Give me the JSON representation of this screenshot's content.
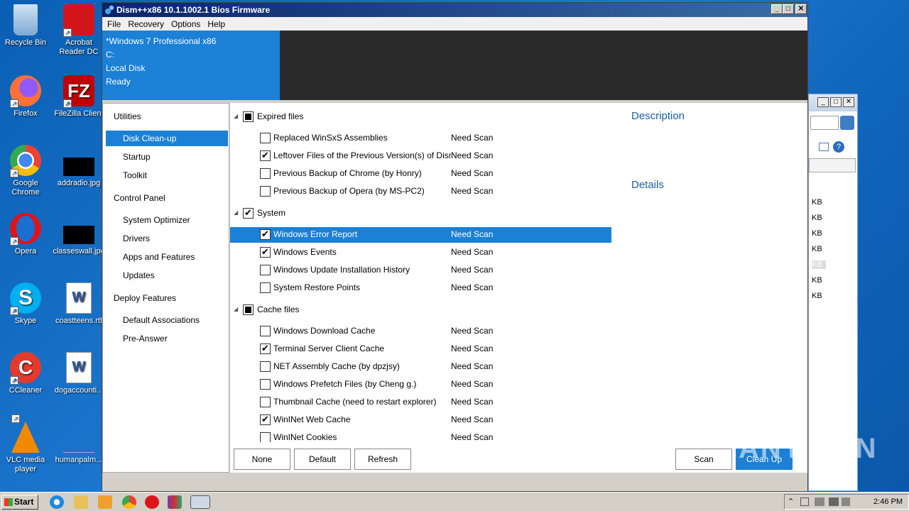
{
  "desktop": {
    "icons": [
      {
        "label": "Recycle Bin",
        "icon": "recycle-bin-icon"
      },
      {
        "label": "Acrobat Reader DC",
        "icon": "acrobat-icon"
      },
      {
        "label": "Firefox",
        "icon": "firefox-icon"
      },
      {
        "label": "FileZilla Client",
        "icon": "filezilla-icon"
      },
      {
        "label": "Google Chrome",
        "icon": "chrome-icon"
      },
      {
        "label": "addradio.jpg",
        "icon": "image-file-icon"
      },
      {
        "label": "Opera",
        "icon": "opera-icon"
      },
      {
        "label": "classeswall.jpg",
        "icon": "image-file-icon"
      },
      {
        "label": "Skype",
        "icon": "skype-icon"
      },
      {
        "label": "coastteens.rtf",
        "icon": "word-doc-icon"
      },
      {
        "label": "CCleaner",
        "icon": "ccleaner-icon"
      },
      {
        "label": "dogaccounti...",
        "icon": "word-doc-icon"
      },
      {
        "label": "VLC media player",
        "icon": "vlc-icon"
      },
      {
        "label": "humanpalm...",
        "icon": "image-file-icon"
      }
    ]
  },
  "background_window": {
    "sizes": [
      "KB",
      "KB",
      "KB",
      "KB",
      "KB",
      "KB",
      "KB"
    ]
  },
  "window": {
    "title": "Dism++x86 10.1.1002.1 Bios Firmware",
    "menu": [
      "File",
      "Recovery",
      "Options",
      "Help"
    ],
    "header": {
      "os": "*Windows 7 Professional x86",
      "drive": "C:",
      "disk": "Local Disk",
      "status": "Ready"
    },
    "sidebar": {
      "sections": [
        {
          "label": "Utilities",
          "items": [
            "Disk Clean-up",
            "Startup",
            "Toolkit"
          ]
        },
        {
          "label": "Control Panel",
          "items": [
            "System Optimizer",
            "Drivers",
            "Apps and Features",
            "Updates"
          ]
        },
        {
          "label": "Deploy Features",
          "items": [
            "Default Associations",
            "Pre-Answer"
          ]
        }
      ],
      "selected": "Disk Clean-up"
    },
    "groups": [
      {
        "name": "Expired files",
        "state": "partial",
        "items": [
          {
            "name": "Replaced WinSxS Assemblies",
            "status": "Need Scan",
            "checked": false
          },
          {
            "name": "Leftover Files of the Previous Version(s) of Dism",
            "status": "Need Scan",
            "checked": true
          },
          {
            "name": "Previous Backup of Chrome (by Honry)",
            "status": "Need Scan",
            "checked": false
          },
          {
            "name": "Previous Backup of Opera (by MS-PC2)",
            "status": "Need Scan",
            "checked": false
          }
        ]
      },
      {
        "name": "System",
        "state": "checked",
        "items": [
          {
            "name": "Windows Error Report",
            "status": "Need Scan",
            "checked": true,
            "selected": true
          },
          {
            "name": "Windows Events",
            "status": "Need Scan",
            "checked": true
          },
          {
            "name": "Windows Update Installation History",
            "status": "Need Scan",
            "checked": false
          },
          {
            "name": "System Restore Points",
            "status": "Need Scan",
            "checked": false
          }
        ]
      },
      {
        "name": "Cache files",
        "state": "partial",
        "items": [
          {
            "name": "Windows Download Cache",
            "status": "Need Scan",
            "checked": false
          },
          {
            "name": "Terminal Server Client Cache",
            "status": "Need Scan",
            "checked": true
          },
          {
            "name": "NET Assembly Cache (by dpzjsy)",
            "status": "Need Scan",
            "checked": false
          },
          {
            "name": "Windows Prefetch Files (by Cheng g.)",
            "status": "Need Scan",
            "checked": false
          },
          {
            "name": "Thumbnail Cache (need to restart explorer)",
            "status": "Need Scan",
            "checked": false
          },
          {
            "name": "WinINet Web Cache",
            "status": "Need Scan",
            "checked": true
          },
          {
            "name": "WinINet Cookies",
            "status": "Need Scan",
            "checked": false
          }
        ]
      }
    ],
    "description": {
      "title": "Description",
      "details": "Details"
    },
    "buttons": {
      "none": "None",
      "default": "Default",
      "refresh": "Refresh",
      "scan": "Scan",
      "cleanup": "Clean Up"
    }
  },
  "taskbar": {
    "start": "Start",
    "clock": "2:46 PM"
  },
  "watermark": "ANY RUN"
}
